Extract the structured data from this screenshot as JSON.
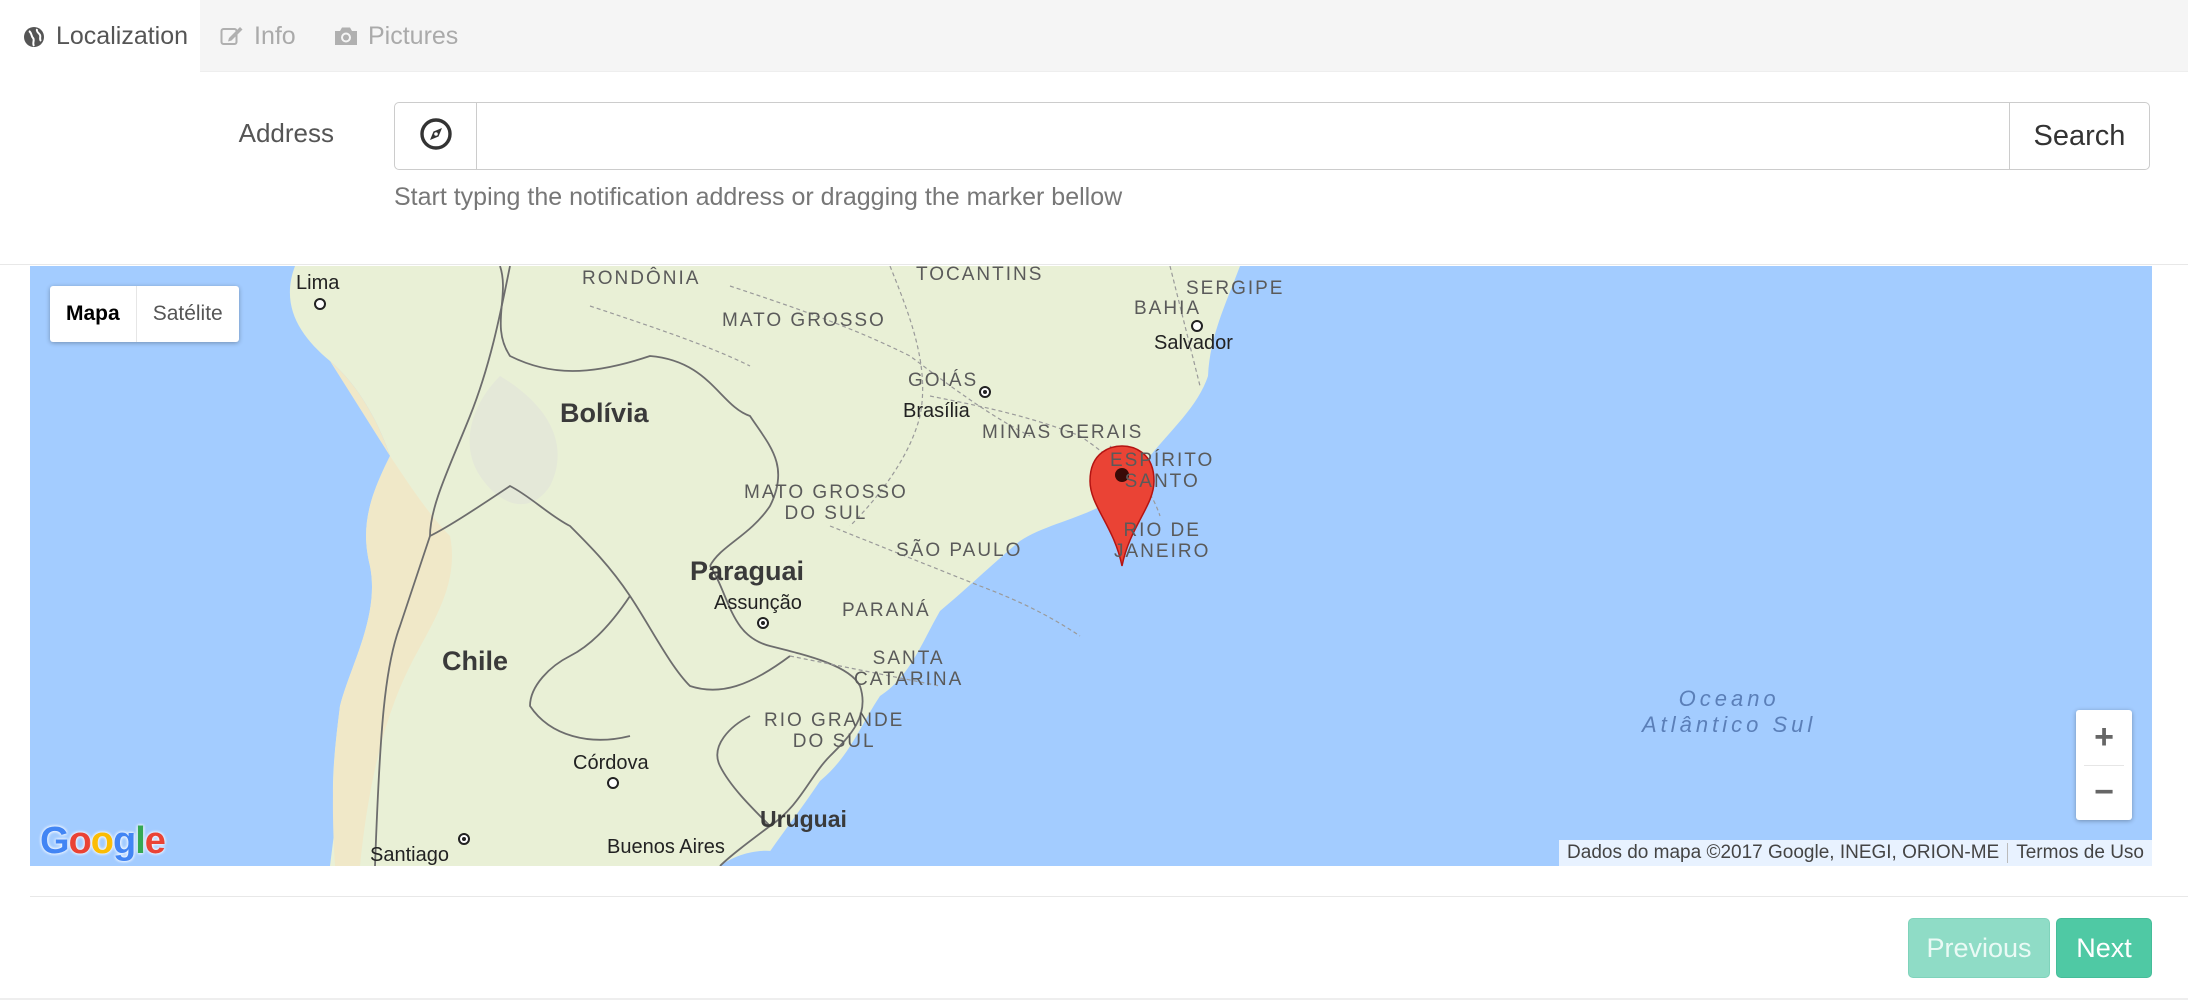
{
  "tabs": [
    {
      "label": "Localization",
      "icon": "globe-icon",
      "active": true
    },
    {
      "label": "Info",
      "icon": "edit-icon",
      "active": false
    },
    {
      "label": "Pictures",
      "icon": "camera-icon",
      "active": false
    }
  ],
  "form": {
    "address_label": "Address",
    "address_value": "",
    "address_placeholder": "",
    "locate_icon": "compass-icon",
    "search_label": "Search",
    "help_text": "Start typing the notification address or dragging the marker bellow"
  },
  "map": {
    "type_controls": {
      "map": "Mapa",
      "satellite": "Satélite",
      "selected": "Mapa"
    },
    "states": {
      "rondonia": "RONDÔNIA",
      "tocantins": "TOCANTINS",
      "bahia": "BAHIA",
      "sergipe": "SERGIPE",
      "mato_grosso": "MATO GROSSO",
      "goias": "GOIÁS",
      "minas_gerais": "MINAS GERAIS",
      "espirito_santo_1": "ESPÍRITO",
      "espirito_santo_2": "SANTO",
      "mato_grosso_do_sul_1": "MATO GROSSO",
      "mato_grosso_do_sul_2": "DO SUL",
      "sao_paulo": "SÃO PAULO",
      "rio_de_janeiro_1": "RIO DE",
      "rio_de_janeiro_2": "JANEIRO",
      "parana": "PARANÁ",
      "santa_catarina_1": "SANTA",
      "santa_catarina_2": "CATARINA",
      "rio_grande_do_sul_1": "RIO GRANDE",
      "rio_grande_do_sul_2": "DO SUL"
    },
    "countries": {
      "bolivia": "Bolívia",
      "paraguai": "Paraguai",
      "chile": "Chile",
      "uruguai": "Uruguai"
    },
    "cities": {
      "lima": "Lima",
      "salvador": "Salvador",
      "brasilia": "Brasília",
      "assuncao": "Assunção",
      "cordova": "Córdova",
      "santiago": "Santiago",
      "buenos_aires": "Buenos Aires"
    },
    "ocean_1": "Oceano",
    "ocean_2": "Atlântico Sul",
    "marker_icon": "map-pin-icon",
    "zoom_in": "+",
    "zoom_out": "−",
    "logo": "Google",
    "attribution": "Dados do mapa ©2017 Google, INEGI, ORION-ME",
    "terms": "Termos de Uso",
    "colors": {
      "water": "#a3ccff",
      "land": "#e8f0d2",
      "marker": "#ea4335"
    }
  },
  "nav": {
    "previous_label": "Previous",
    "next_label": "Next",
    "accent": "#4fc9a4"
  }
}
